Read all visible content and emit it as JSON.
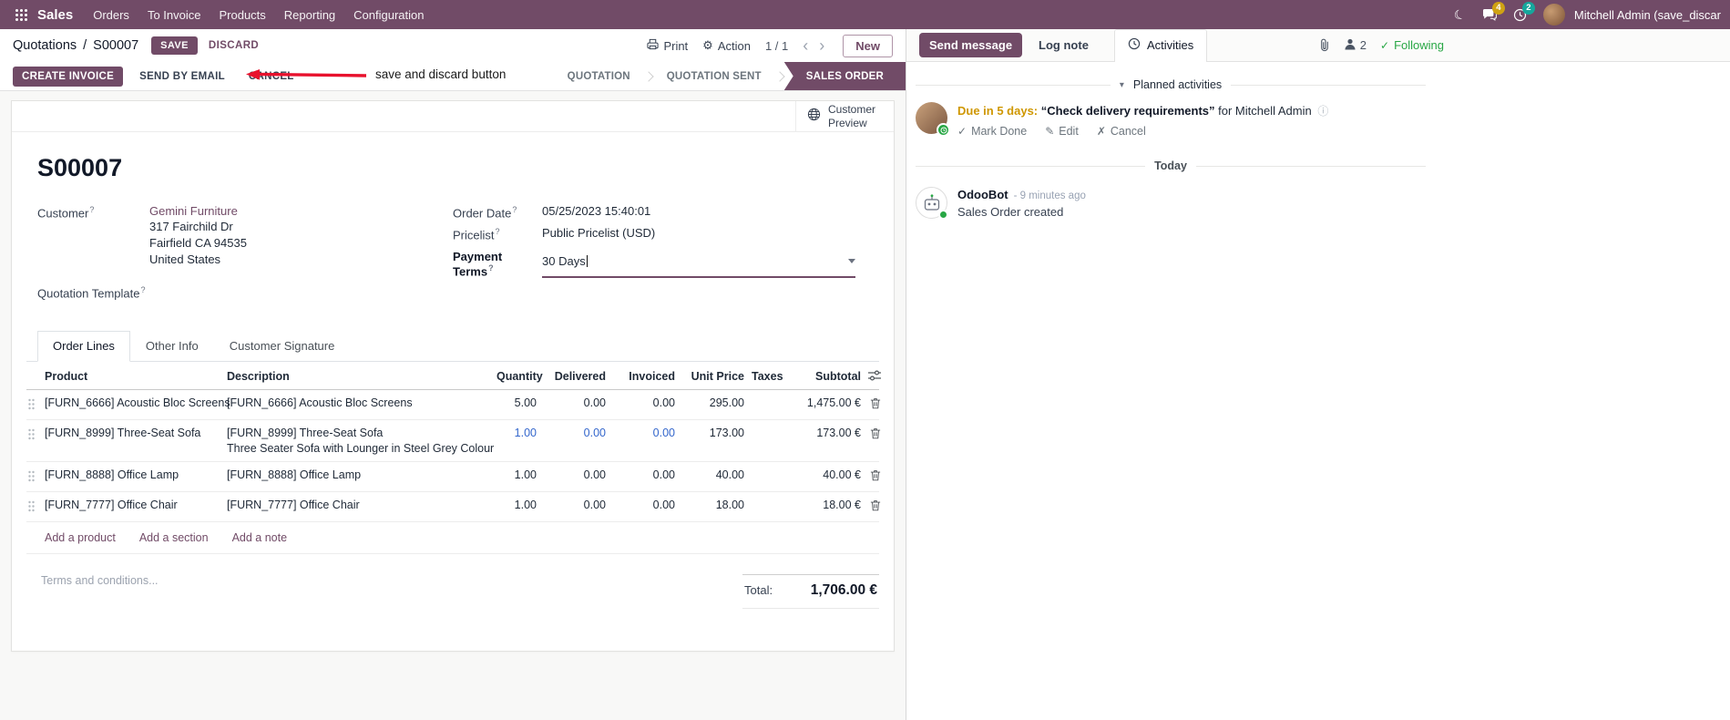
{
  "colors": {
    "brand": "#714B67",
    "success": "#28a745",
    "warning": "#cf9700",
    "highlight_blue": "#3366cc",
    "annotation_red": "#e8112d"
  },
  "icons": {
    "moon": "☾",
    "gear": "⚙",
    "chevron_left": "‹",
    "chevron_right": "›",
    "check": "✓",
    "caret_down": "▾",
    "info": "ⓘ",
    "pencil": "✎",
    "cross": "✗"
  },
  "topbar": {
    "brand": "Sales",
    "menus": [
      "Orders",
      "To Invoice",
      "Products",
      "Reporting",
      "Configuration"
    ],
    "messages_badge": "4",
    "activities_badge": "2",
    "user": "Mitchell Admin (save_discar"
  },
  "breadcrumb": {
    "parent": "Quotations",
    "separator": "/",
    "current": "S00007"
  },
  "actions": {
    "save": "SAVE",
    "discard": "DISCARD",
    "print": "Print",
    "action": "Action",
    "pager": "1 / 1",
    "new": "New"
  },
  "annotation": {
    "text": "save and discard button"
  },
  "statusbar": {
    "create_invoice": "CREATE INVOICE",
    "send_by_email": "SEND BY EMAIL",
    "cancel": "CANCEL",
    "stages": [
      {
        "label": "QUOTATION",
        "active": false
      },
      {
        "label": "QUOTATION SENT",
        "active": false
      },
      {
        "label": "SALES ORDER",
        "active": true
      }
    ]
  },
  "form": {
    "help_marker": "?",
    "preview_button": "Customer Preview",
    "title": "S00007",
    "fields": {
      "customer_label": "Customer",
      "customer_name": "Gemini Furniture",
      "address": [
        "317 Fairchild Dr",
        "Fairfield CA 94535",
        "United States"
      ],
      "quotation_template_label": "Quotation Template",
      "order_date_label": "Order Date",
      "order_date_value": "05/25/2023 15:40:01",
      "pricelist_label": "Pricelist",
      "pricelist_value": "Public Pricelist (USD)",
      "payment_terms_label": "Payment Terms",
      "payment_terms_value": "30 Days"
    },
    "tabs": [
      {
        "label": "Order Lines",
        "active": true
      },
      {
        "label": "Other Info",
        "active": false
      },
      {
        "label": "Customer Signature",
        "active": false
      }
    ],
    "table": {
      "headers": [
        "Product",
        "Description",
        "Quantity",
        "Delivered",
        "Invoiced",
        "Unit Price",
        "Taxes",
        "Subtotal"
      ],
      "lines": [
        {
          "product": "[FURN_6666] Acoustic Bloc Screens",
          "description": "[FURN_6666] Acoustic Bloc Screens",
          "description2": "",
          "quantity": "5.00",
          "delivered": "0.00",
          "invoiced": "0.00",
          "unit_price": "295.00",
          "taxes": "",
          "subtotal": "1,475.00 €",
          "highlighted": false
        },
        {
          "product": "[FURN_8999] Three-Seat Sofa",
          "description": "[FURN_8999] Three-Seat Sofa",
          "description2": "Three Seater Sofa with Lounger in Steel Grey Colour",
          "quantity": "1.00",
          "delivered": "0.00",
          "invoiced": "0.00",
          "unit_price": "173.00",
          "taxes": "",
          "subtotal": "173.00 €",
          "highlighted": true
        },
        {
          "product": "[FURN_8888] Office Lamp",
          "description": "[FURN_8888] Office Lamp",
          "description2": "",
          "quantity": "1.00",
          "delivered": "0.00",
          "invoiced": "0.00",
          "unit_price": "40.00",
          "taxes": "",
          "subtotal": "40.00 €",
          "highlighted": false
        },
        {
          "product": "[FURN_7777] Office Chair",
          "description": "[FURN_7777] Office Chair",
          "description2": "",
          "quantity": "1.00",
          "delivered": "0.00",
          "invoiced": "0.00",
          "unit_price": "18.00",
          "taxes": "",
          "subtotal": "18.00 €",
          "highlighted": false
        }
      ],
      "add_links": [
        "Add a product",
        "Add a section",
        "Add a note"
      ]
    },
    "terms_placeholder": "Terms and conditions...",
    "total_label": "Total:",
    "total_value": "1,706.00 €"
  },
  "chatter": {
    "send_message": "Send message",
    "log_note": "Log note",
    "activities_tab": "Activities",
    "followers_count": "2",
    "following": "Following",
    "planned_header": "Planned activities",
    "activity": {
      "due": "Due in 5 days:",
      "summary": "“Check delivery requirements”",
      "for_user": "for Mitchell Admin",
      "mark_done": "Mark Done",
      "edit": "Edit",
      "cancel": "Cancel"
    },
    "today": "Today",
    "message": {
      "author": "OdooBot",
      "timestamp": "- 9 minutes ago",
      "body": "Sales Order created"
    }
  }
}
